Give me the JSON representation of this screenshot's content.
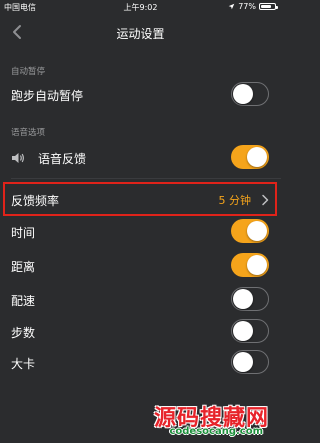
{
  "status_bar": {
    "carrier": "中国电信",
    "time": "上午9:02",
    "battery_text": "77%",
    "battery_level": 0.77
  },
  "nav": {
    "title": "运动设置",
    "back_icon": "chevron-left-icon"
  },
  "sections": {
    "auto_pause": {
      "label": "自动暂停",
      "items": [
        {
          "label": "跑步自动暂停",
          "on": false
        }
      ]
    },
    "voice": {
      "label": "语音选项",
      "voice_feedback": {
        "label": "语音反馈",
        "on": true,
        "icon": "speaker-icon"
      },
      "frequency": {
        "label": "反馈频率",
        "value": "5 分钟"
      },
      "items": [
        {
          "label": "时间",
          "on": true
        },
        {
          "label": "距离",
          "on": true
        },
        {
          "label": "配速",
          "on": false
        },
        {
          "label": "步数",
          "on": false
        },
        {
          "label": "大卡",
          "on": false
        }
      ]
    }
  },
  "watermark": {
    "title": "源码搜藏网",
    "domain": "codesocang.com"
  },
  "colors": {
    "background": "#2b2c2e",
    "accent": "#f5a41b",
    "highlight": "#e0231a",
    "section_label": "#9a9b9d"
  }
}
